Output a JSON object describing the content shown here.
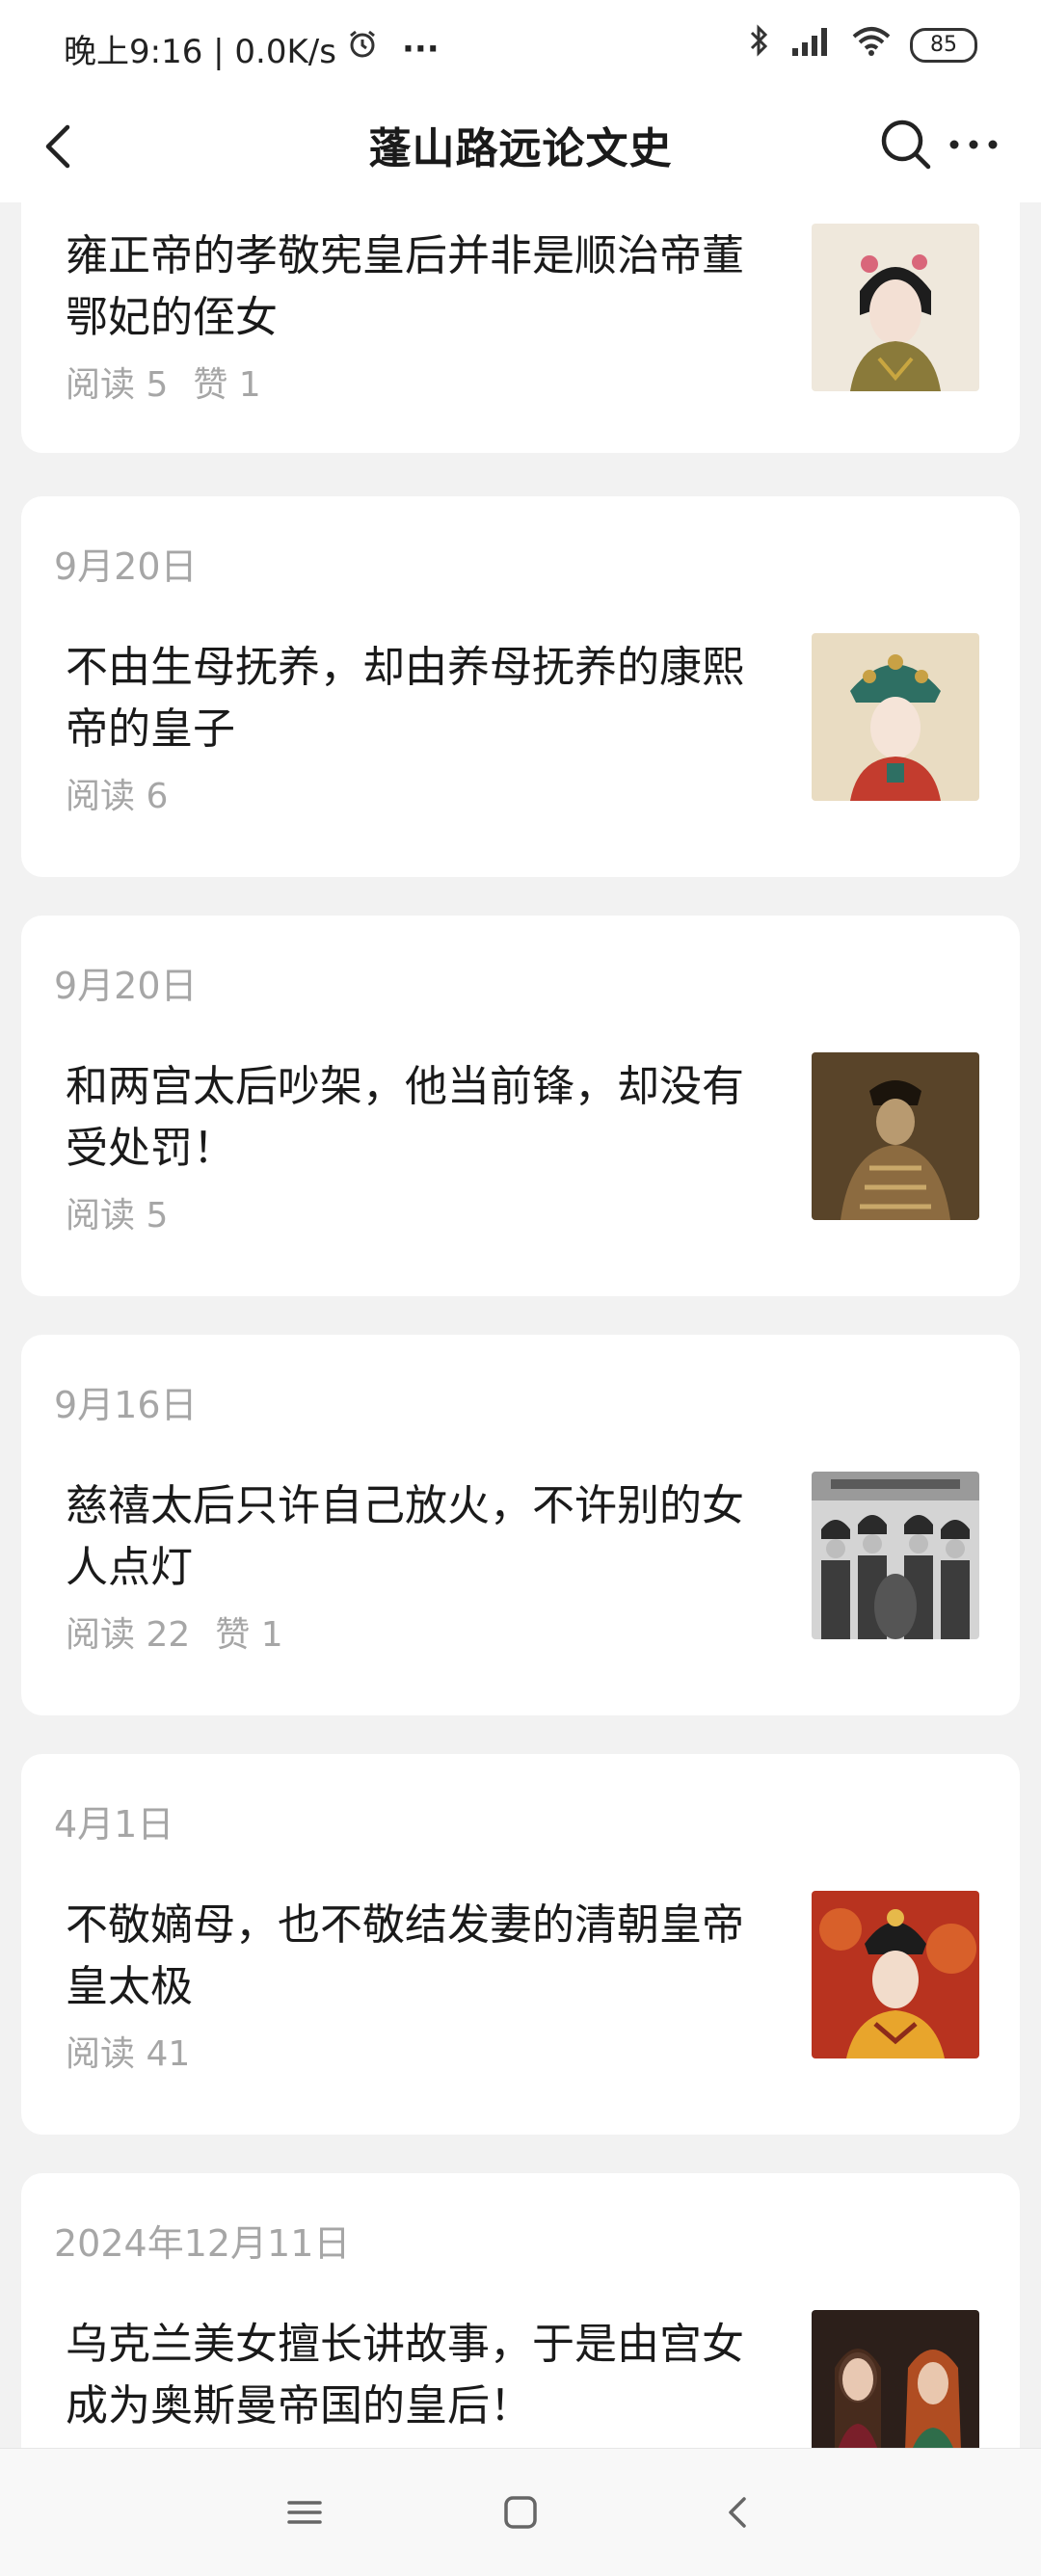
{
  "status_bar": {
    "time": "晚上9:16 | 0.0K/s",
    "more": "···",
    "battery": "85"
  },
  "header": {
    "title": "蓬山路远论文史"
  },
  "articles": [
    {
      "date": "",
      "title_lines": [
        "雍正帝的孝敬宪皇后并非是顺治帝董",
        "鄂妃的侄女"
      ],
      "reads": "阅读 5",
      "likes": "赞 1",
      "thumb": "portrait-consort-pink"
    },
    {
      "date": "9月20日",
      "title_lines": [
        "不由生母抚养，却由养母抚养的康熙",
        "帝的皇子"
      ],
      "reads": "阅读 6",
      "likes": "",
      "thumb": "portrait-consort-crown"
    },
    {
      "date": "9月20日",
      "title_lines": [
        "和两宫太后吵架，他当前锋，却没有",
        "受处罚！"
      ],
      "reads": "阅读 5",
      "likes": "",
      "thumb": "photo-empress-dowager-sepia"
    },
    {
      "date": "9月16日",
      "title_lines": [
        "慈禧太后只许自己放火，不许别的女",
        "人点灯"
      ],
      "reads": "阅读 22",
      "likes": "赞 1",
      "thumb": "photo-court-ladies-bw"
    },
    {
      "date": "4月1日",
      "title_lines": [
        "不敬嫡母，也不敬结发妻的清朝皇帝",
        "皇太极"
      ],
      "reads": "阅读 41",
      "likes": "",
      "thumb": "portrait-empress-red"
    },
    {
      "date": "2024年12月11日",
      "title_lines": [
        "乌克兰美女擅长讲故事，于是由宫女",
        "成为奥斯曼帝国的皇后！"
      ],
      "reads": "",
      "likes": "",
      "thumb": "photo-ottoman-women"
    }
  ],
  "icons": {
    "back": "chevron-left-icon",
    "search": "search-icon",
    "more": "more-horizontal-icon",
    "nav_menu": "menu-icon",
    "nav_home": "home-square-icon",
    "nav_back": "back-triangle-icon"
  }
}
